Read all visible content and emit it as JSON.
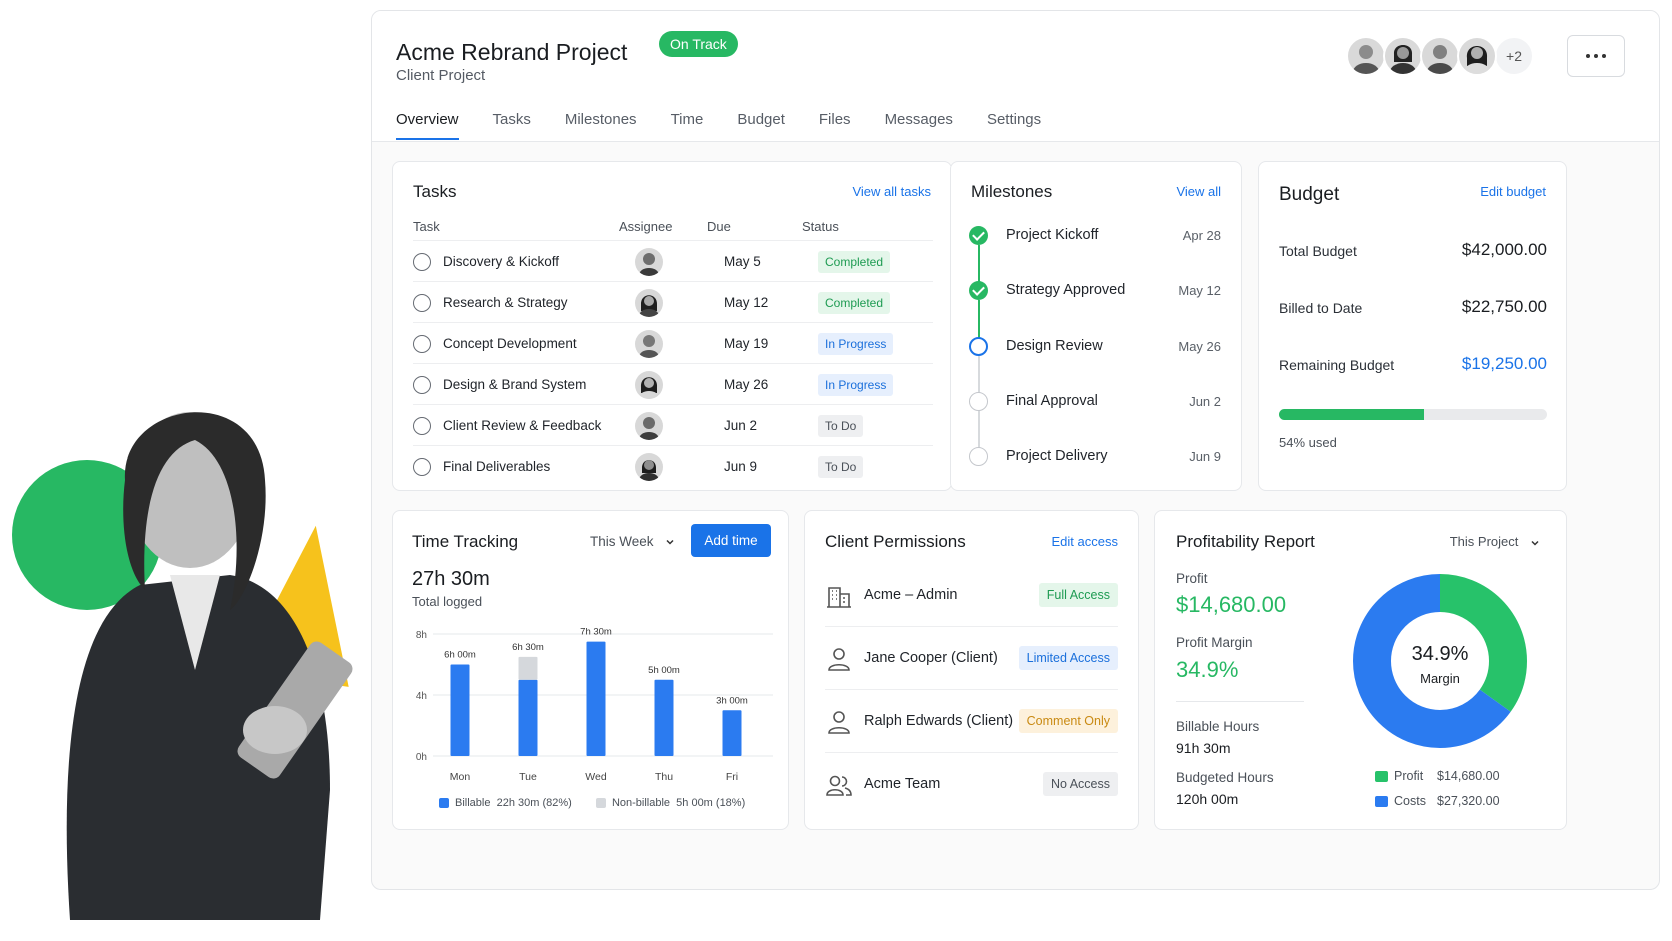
{
  "project": {
    "title": "Acme Rebrand Project",
    "status": "On Track",
    "subtitle": "Client Project",
    "more_avatars": "+2"
  },
  "tabs": [
    "Overview",
    "Tasks",
    "Milestones",
    "Time",
    "Budget",
    "Files",
    "Messages",
    "Settings"
  ],
  "tasks": {
    "title": "Tasks",
    "link": "View all tasks",
    "headers": {
      "task": "Task",
      "assignee": "Assignee",
      "due": "Due",
      "status": "Status"
    },
    "rows": [
      {
        "name": "Discovery & Kickoff",
        "due": "May 5",
        "status": "Completed"
      },
      {
        "name": "Research & Strategy",
        "due": "May 12",
        "status": "Completed"
      },
      {
        "name": "Concept Development",
        "due": "May 19",
        "status": "In Progress"
      },
      {
        "name": "Design & Brand System",
        "due": "May 26",
        "status": "In Progress"
      },
      {
        "name": "Client Review & Feedback",
        "due": "Jun 2",
        "status": "To Do"
      },
      {
        "name": "Final Deliverables",
        "due": "Jun 9",
        "status": "To Do"
      }
    ]
  },
  "milestones": {
    "title": "Milestones",
    "link": "View all",
    "items": [
      {
        "name": "Project Kickoff",
        "date": "Apr 28",
        "state": "done"
      },
      {
        "name": "Strategy Approved",
        "date": "May 12",
        "state": "done"
      },
      {
        "name": "Design Review",
        "date": "May 26",
        "state": "current"
      },
      {
        "name": "Final Approval",
        "date": "Jun 2",
        "state": "todo"
      },
      {
        "name": "Project Delivery",
        "date": "Jun 9",
        "state": "todo"
      }
    ]
  },
  "budget": {
    "title": "Budget",
    "link": "Edit budget",
    "total_label": "Total Budget",
    "total_value": "$42,000.00",
    "billed_label": "Billed to Date",
    "billed_value": "$22,750.00",
    "remaining_label": "Remaining Budget",
    "remaining_value": "$19,250.00",
    "used_fraction": 0.54,
    "used_text": "54% used"
  },
  "time_tracking": {
    "title": "Time Tracking",
    "period": "This Week",
    "add_label": "Add time",
    "total": "27h 30m",
    "total_label": "Total logged",
    "legend_billable": "Billable",
    "legend_billable_value": "22h 30m (82%)",
    "legend_nonbillable": "Non-billable",
    "legend_nonbillable_value": "5h 00m (18%)"
  },
  "chart_data": {
    "type": "bar",
    "categories": [
      "Mon",
      "Tue",
      "Wed",
      "Thu",
      "Fri"
    ],
    "series": [
      {
        "name": "Billable",
        "values": [
          6,
          5,
          7.5,
          5,
          3
        ]
      },
      {
        "name": "Non-billable",
        "values": [
          0,
          1.5,
          0,
          0,
          0
        ]
      }
    ],
    "data_labels": [
      "6h 00m",
      "6h 30m",
      "7h 30m",
      "5h 00m",
      "3h 00m"
    ],
    "y_ticks": [
      "8h",
      "4h",
      "0h"
    ],
    "ylim": [
      0,
      8
    ],
    "stacked": true,
    "grid": true,
    "colors": {
      "billable": "#2b7bf0",
      "nonbillable": "#d5d8dc"
    }
  },
  "permissions": {
    "title": "Client Permissions",
    "link": "Edit access",
    "rows": [
      {
        "name": "Acme – Admin",
        "access": "Full Access",
        "icon": "building-icon"
      },
      {
        "name": "Jane Cooper (Client)",
        "access": "Limited Access",
        "icon": "user-icon"
      },
      {
        "name": "Ralph Edwards (Client)",
        "access": "Comment Only",
        "icon": "user-icon"
      },
      {
        "name": "Acme Team",
        "access": "No Access",
        "icon": "users-icon"
      }
    ]
  },
  "profitability": {
    "title": "Profitability Report",
    "period": "This Project",
    "profit_label": "Profit",
    "profit_value": "$14,680.00",
    "margin_label": "Profit Margin",
    "margin_value": "34.9%",
    "billable_label": "Billable Hours",
    "billable_value": "91h 30m",
    "budgeted_label": "Budgeted Hours",
    "budgeted_value": "120h 00m",
    "donut_center": "34.9%",
    "donut_sub": "Margin",
    "legend_profit": "Profit",
    "legend_profit_value": "$14,680.00",
    "legend_costs": "Costs",
    "legend_costs_value": "$27,320.00",
    "profit_fraction": 0.349,
    "colors": {
      "profit": "#27c26a",
      "costs": "#2b7bf0"
    }
  }
}
